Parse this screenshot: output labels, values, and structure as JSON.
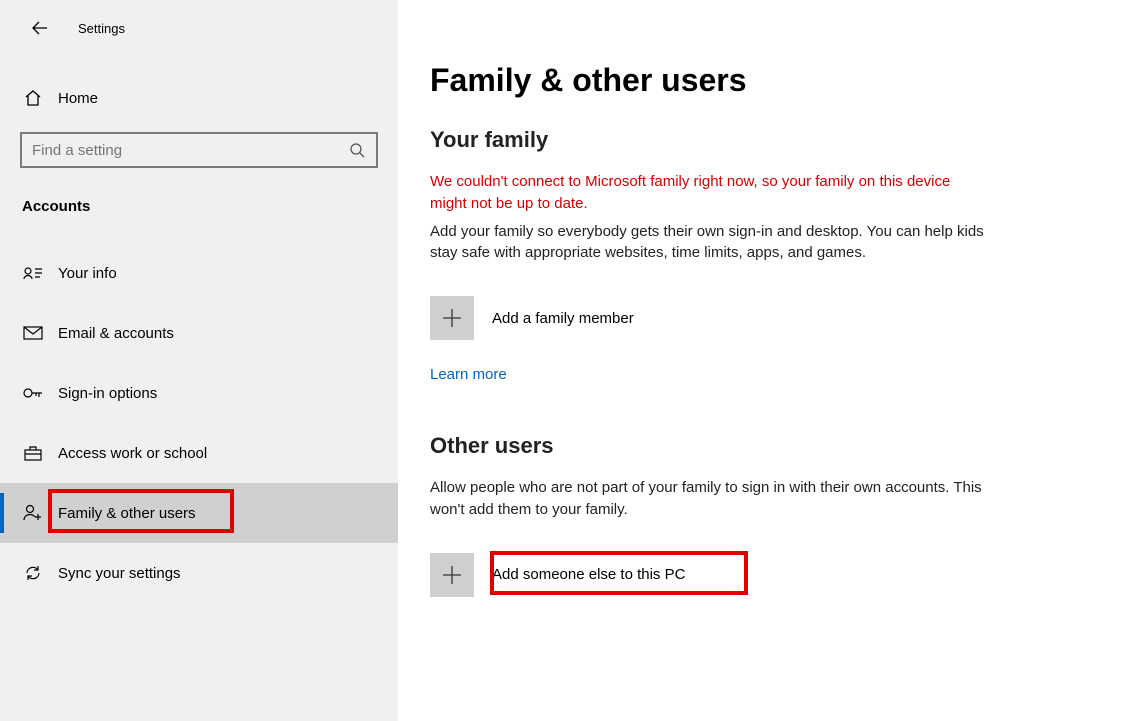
{
  "header": {
    "settings_title": "Settings"
  },
  "sidebar": {
    "home_label": "Home",
    "search_placeholder": "Find a setting",
    "category_label": "Accounts",
    "items": [
      {
        "label": "Your info"
      },
      {
        "label": "Email & accounts"
      },
      {
        "label": "Sign-in options"
      },
      {
        "label": "Access work or school"
      },
      {
        "label": "Family & other users"
      },
      {
        "label": "Sync your settings"
      }
    ]
  },
  "main": {
    "page_title": "Family & other users",
    "family": {
      "heading": "Your family",
      "error_text": "We couldn't connect to Microsoft family right now, so your family on this device might not be up to date.",
      "body_text": "Add your family so everybody gets their own sign-in and desktop. You can help kids stay safe with appropriate websites, time limits, apps, and games.",
      "add_label": "Add a family member",
      "learn_more": "Learn more"
    },
    "other": {
      "heading": "Other users",
      "body_text": "Allow people who are not part of your family to sign in with their own accounts. This won't add them to your family.",
      "add_label": "Add someone else to this PC"
    }
  }
}
